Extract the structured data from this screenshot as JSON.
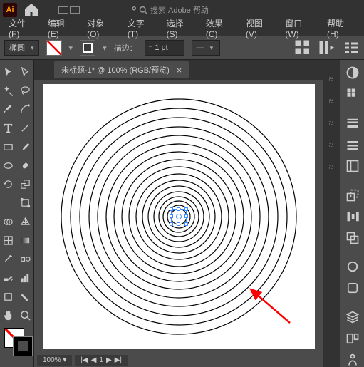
{
  "top": {
    "search_placeholder": "搜索 Adobe 帮助"
  },
  "menu": {
    "file": "文件(F)",
    "edit": "编辑(E)",
    "object": "对象(O)",
    "type": "文字(T)",
    "select": "选择(S)",
    "effect": "效果(C)",
    "view": "视图(V)",
    "window": "窗口(W)",
    "help": "帮助(H)"
  },
  "ctrl": {
    "shape": "椭圆",
    "stroke_label": "描边：",
    "stroke_pt": "1 pt"
  },
  "doc": {
    "tab_title": "未标题-1* @ 100% (RGB/预览)"
  },
  "status": {
    "zoom": "100%",
    "artboard": "1"
  }
}
